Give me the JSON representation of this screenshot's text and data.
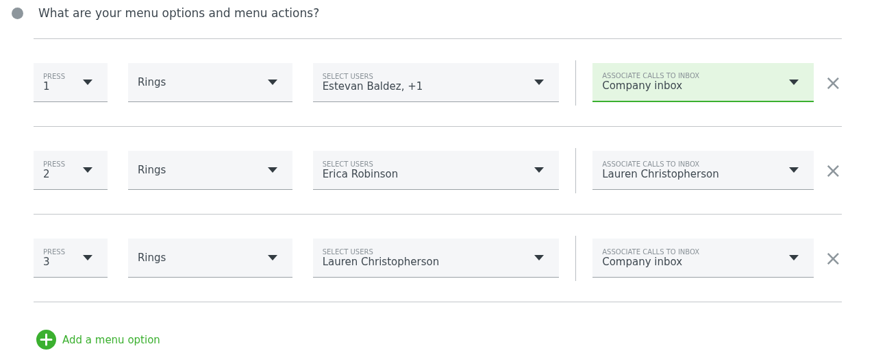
{
  "question": "What are your menu options and menu actions?",
  "options": [
    {
      "press": {
        "label": "PRESS",
        "value": "1"
      },
      "action": {
        "value": "Rings"
      },
      "users": {
        "label": "SELECT USERS",
        "value": "Estevan Baldez, +1"
      },
      "inbox": {
        "label": "ASSOCIATE CALLS TO INBOX",
        "value": "Company inbox",
        "focused": true
      },
      "remove": "×"
    },
    {
      "press": {
        "label": "PRESS",
        "value": "2"
      },
      "action": {
        "value": "Rings"
      },
      "users": {
        "label": "SELECT USERS",
        "value": "Erica Robinson"
      },
      "inbox": {
        "label": "ASSOCIATE CALLS TO INBOX",
        "value": "Lauren Christopherson",
        "focused": false
      },
      "remove": "×"
    },
    {
      "press": {
        "label": "PRESS",
        "value": "3"
      },
      "action": {
        "value": "Rings"
      },
      "users": {
        "label": "SELECT USERS",
        "value": "Lauren Christopherson"
      },
      "inbox": {
        "label": "ASSOCIATE CALLS TO INBOX",
        "value": "Company inbox",
        "focused": false
      },
      "remove": "×"
    }
  ],
  "add_button": "Add a menu option"
}
